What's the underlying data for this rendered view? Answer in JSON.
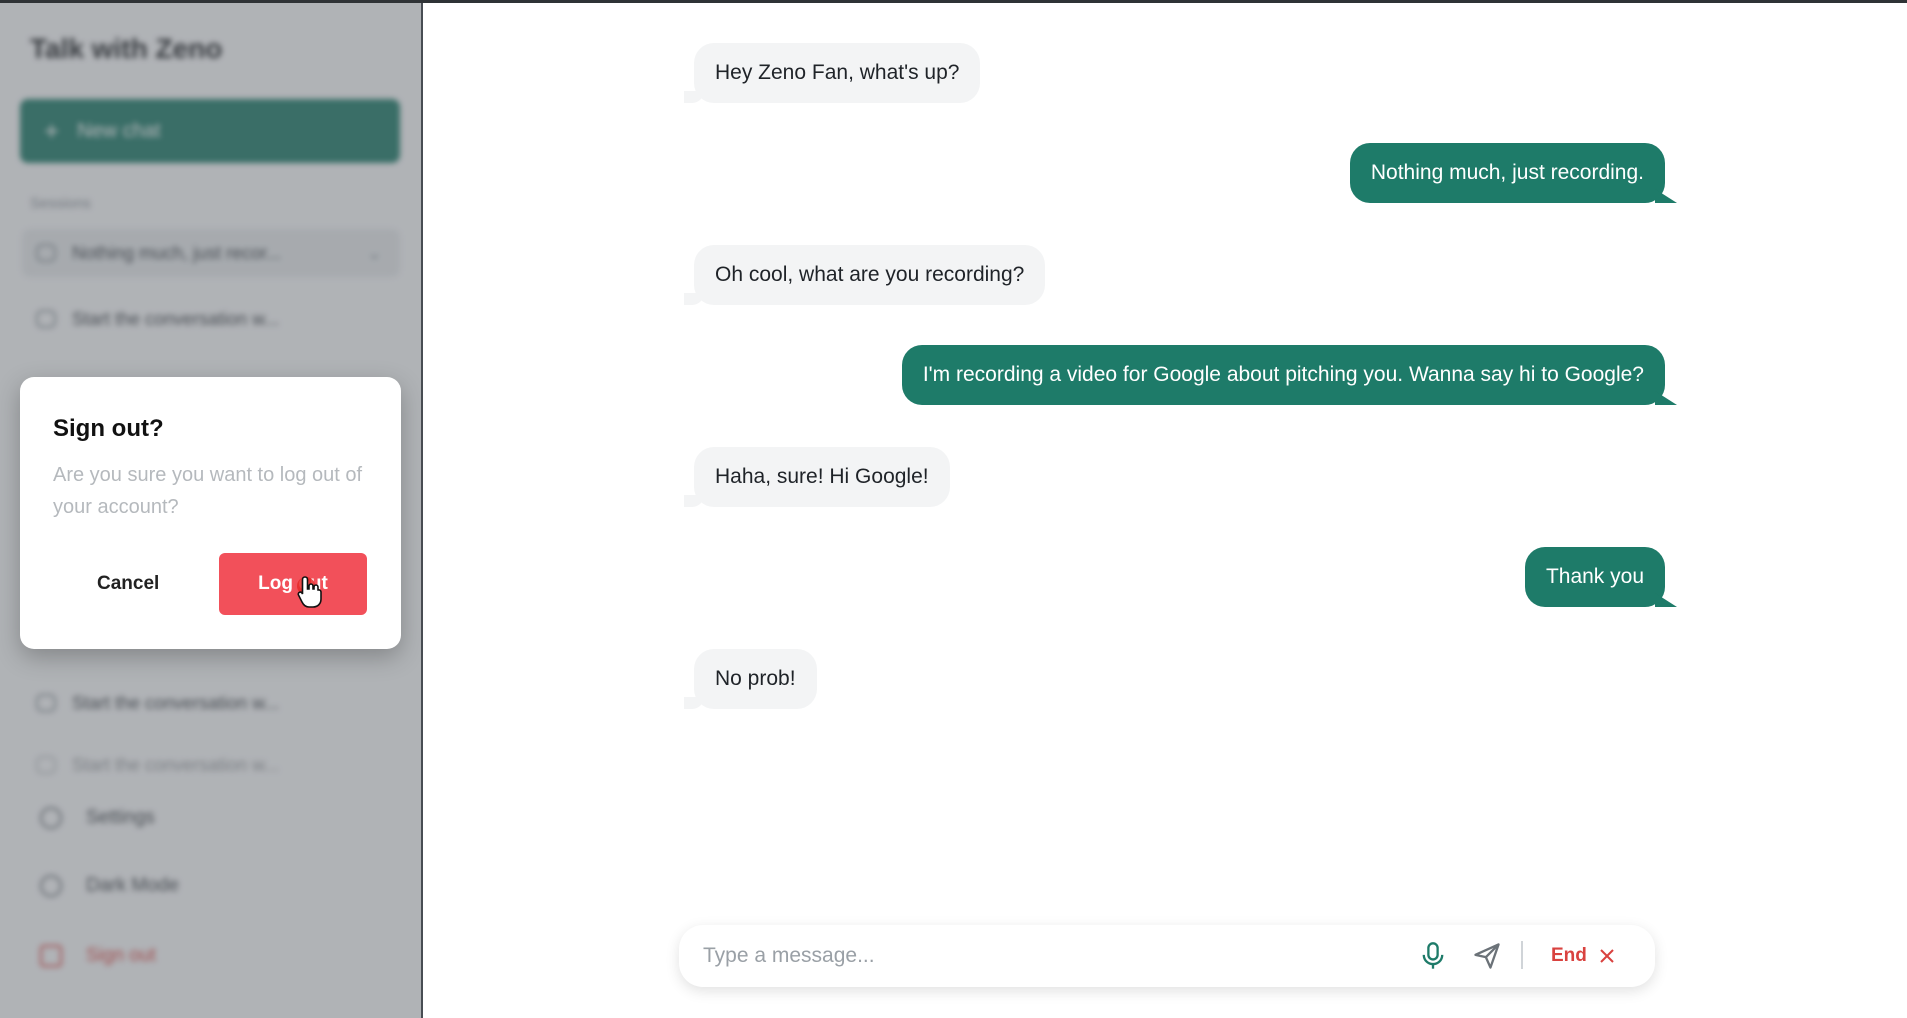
{
  "sidebar": {
    "title": "Talk with Zeno",
    "new_chat_label": "New chat",
    "section_label": "Sessions",
    "conversations": [
      {
        "label": "Nothing much, just recor..."
      },
      {
        "label": "Start the conversation w..."
      },
      {
        "label": "Start the conversation w..."
      },
      {
        "label": "Start the conversation w..."
      }
    ],
    "settings_label": "Settings",
    "dark_mode_label": "Dark Mode",
    "sign_out_label": "Sign out"
  },
  "modal": {
    "title": "Sign out?",
    "message": "Are you sure you want to log out of your account?",
    "cancel_label": "Cancel",
    "confirm_label": "Log out"
  },
  "messages": [
    {
      "role": "bot",
      "text": "Hey Zeno Fan, what's up?"
    },
    {
      "role": "user",
      "text": "Nothing much, just recording."
    },
    {
      "role": "bot",
      "text": "Oh cool, what are you recording?"
    },
    {
      "role": "user",
      "text": "I'm recording a video for Google about pitching you. Wanna say hi to Google?"
    },
    {
      "role": "bot",
      "text": "Haha, sure! Hi Google!"
    },
    {
      "role": "user",
      "text": "Thank you"
    },
    {
      "role": "bot",
      "text": "No prob!"
    }
  ],
  "composer": {
    "placeholder": "Type a message...",
    "end_label": "End"
  },
  "icons": {
    "mic": "microphone-icon",
    "send": "send-icon",
    "end": "close-icon"
  },
  "colors": {
    "accent": "#1e7b69",
    "danger": "#f2505a"
  }
}
